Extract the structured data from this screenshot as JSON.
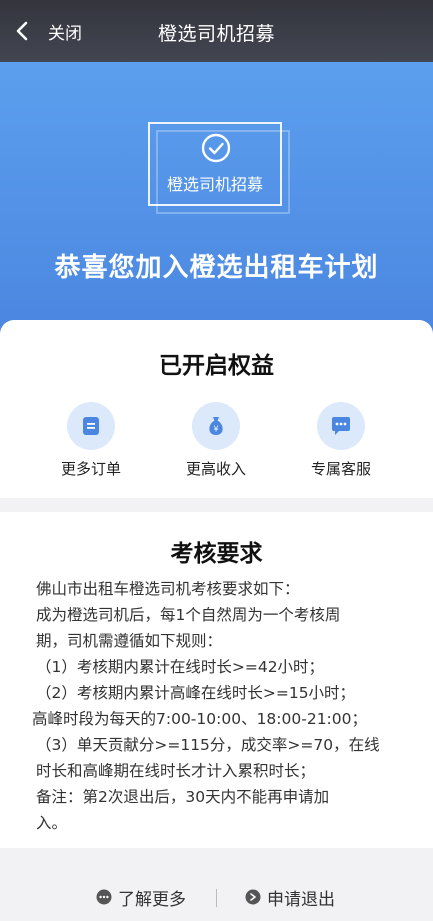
{
  "navbar": {
    "close_label": "关闭",
    "title": "橙选司机招募"
  },
  "hero": {
    "badge_label": "橙选司机招募",
    "title": "恭喜您加入橙选出租车计划"
  },
  "benefits": {
    "title": "已开启权益",
    "items": [
      {
        "label": "更多订单",
        "icon": "order-icon"
      },
      {
        "label": "更高收入",
        "icon": "money-bag-icon"
      },
      {
        "label": "专属客服",
        "icon": "chat-icon"
      }
    ]
  },
  "requirements": {
    "title": "考核要求",
    "lines": [
      "佛山市出租车橙选司机考核要求如下：",
      "成为橙选司机后，每1个自然周为一个考核周",
      "期，司机需遵循如下规则：",
      "（1）考核期内累计在线时长>=42小时；",
      "（2）考核期内累计高峰在线时长>=15小时；",
      "高峰时段为每天的7:00-10:00、18:00-21:00；",
      "（3）单天贡献分>=115分，成交率>=70，在线",
      "时长和高峰期在线时长才计入累积时长；",
      "备注：第2次退出后，30天内不能再申请加",
      "入。"
    ]
  },
  "footer": {
    "learn_more_label": "了解更多",
    "apply_exit_label": "申请退出"
  },
  "colors": {
    "accent": "#4b86e0",
    "nav_bg": "#3a3c45",
    "icon_bg": "#dce9fb"
  }
}
